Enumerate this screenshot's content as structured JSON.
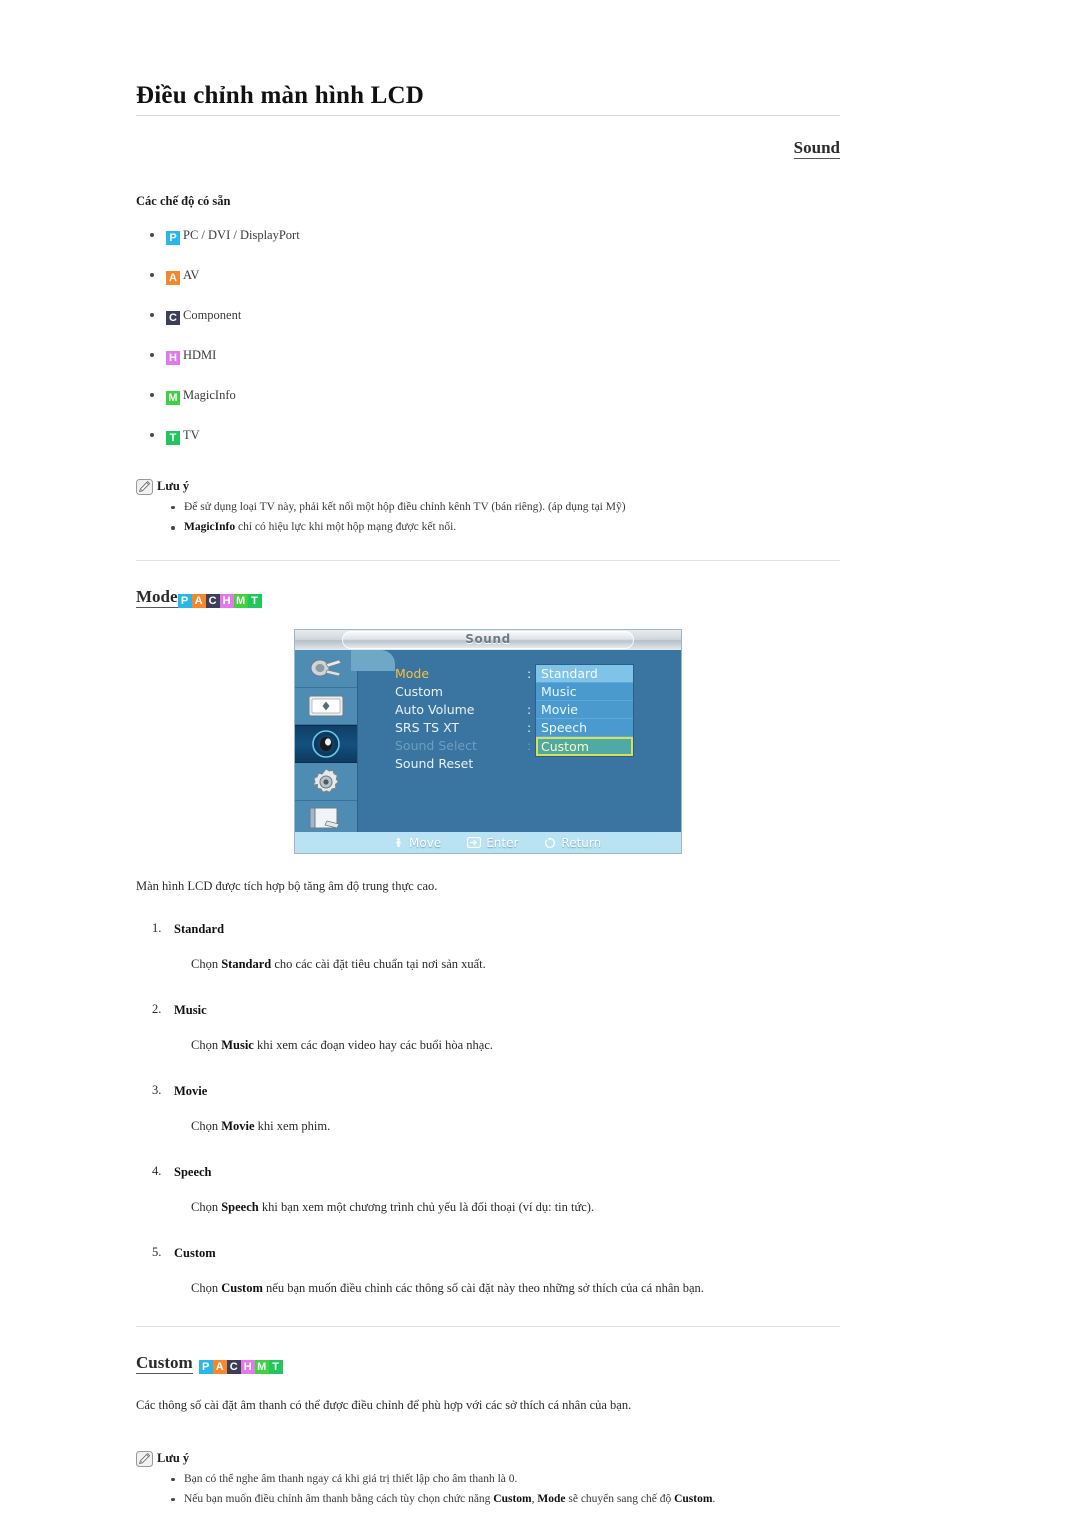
{
  "header": {
    "doc_title": "Điều chỉnh màn hình LCD",
    "section_title": "Sound"
  },
  "available_modes": {
    "heading": "Các chế độ có sẵn",
    "items": [
      {
        "badge": "P",
        "badge_color": "#29b6e8",
        "label": "PC / DVI / DisplayPort"
      },
      {
        "badge": "A",
        "badge_color": "#f5872e",
        "label": "AV"
      },
      {
        "badge": "C",
        "badge_color": "#3d3f58",
        "label": "Component"
      },
      {
        "badge": "H",
        "badge_color": "#e07ae8",
        "label": "HDMI"
      },
      {
        "badge": "M",
        "badge_color": "#3fd13f",
        "label": "MagicInfo"
      },
      {
        "badge": "T",
        "badge_color": "#22c55e",
        "label": "TV"
      }
    ]
  },
  "note_top": {
    "icon": "note-pencil-icon",
    "title": "Lưu ý",
    "items": [
      {
        "prefix": "",
        "bold": "",
        "text": "Để sử dụng loại TV này, phải kết nối một hộp điều chỉnh kênh TV (bán riêng). (áp dụng tại Mỹ)"
      },
      {
        "prefix": "",
        "bold": "MagicInfo",
        "text": " chỉ có hiệu lực khi một hộp mạng được kết nối."
      }
    ]
  },
  "mode_block": {
    "heading": "Mode",
    "badges": [
      {
        "badge": "P",
        "badge_color": "#29b6e8"
      },
      {
        "badge": "A",
        "badge_color": "#f5872e"
      },
      {
        "badge": "C",
        "badge_color": "#3d3f58"
      },
      {
        "badge": "H",
        "badge_color": "#e07ae8"
      },
      {
        "badge": "M",
        "badge_color": "#3fd13f"
      },
      {
        "badge": "T",
        "badge_color": "#22c55e"
      }
    ],
    "intro": "Màn hình LCD được tích hợp bộ tăng âm độ trung thực cao.",
    "items": [
      {
        "num": "1.",
        "title": "Standard",
        "desc_pre": "Chọn ",
        "desc_bold": "Standard",
        "desc_post": " cho các cài đặt tiêu chuẩn tại nơi sản xuất."
      },
      {
        "num": "2.",
        "title": "Music",
        "desc_pre": "Chọn ",
        "desc_bold": "Music",
        "desc_post": " khi xem các đoạn video hay các buổi hòa nhạc."
      },
      {
        "num": "3.",
        "title": "Movie",
        "desc_pre": "Chọn ",
        "desc_bold": "Movie",
        "desc_post": " khi xem phim."
      },
      {
        "num": "4.",
        "title": "Speech",
        "desc_pre": "Chọn ",
        "desc_bold": "Speech",
        "desc_post": " khi bạn xem một chương trình chủ yếu là đối thoại (ví dụ: tin tức)."
      },
      {
        "num": "5.",
        "title": "Custom",
        "desc_pre": "Chọn ",
        "desc_bold": "Custom",
        "desc_post": " nếu bạn muốn điều chỉnh các thông số cài đặt này theo những sở thích của cá nhân bạn."
      }
    ]
  },
  "osd": {
    "title": "Sound",
    "sidebar_icons": [
      "input-source-icon",
      "picture-icon",
      "sound-icon",
      "setup-gear-icon",
      "multi-control-icon"
    ],
    "active_sidebar_index": 2,
    "menu_items": [
      {
        "label": "Mode",
        "state": "selected",
        "colon": ":"
      },
      {
        "label": "Custom",
        "state": "normal",
        "colon": ""
      },
      {
        "label": "Auto Volume",
        "state": "normal",
        "colon": ":"
      },
      {
        "label": "SRS TS XT",
        "state": "normal",
        "colon": ":"
      },
      {
        "label": "Sound Select",
        "state": "disabled",
        "colon": ":"
      },
      {
        "label": "Sound Reset",
        "state": "normal",
        "colon": ""
      }
    ],
    "options": [
      {
        "label": "Standard",
        "state": "first"
      },
      {
        "label": "Music",
        "state": "normal"
      },
      {
        "label": "Movie",
        "state": "normal"
      },
      {
        "label": "Speech",
        "state": "normal"
      },
      {
        "label": "Custom",
        "state": "highlighted"
      }
    ],
    "hints": [
      {
        "icon": "move-dpad-icon",
        "label": "Move"
      },
      {
        "icon": "enter-icon",
        "label": "Enter"
      },
      {
        "icon": "return-icon",
        "label": "Return"
      }
    ]
  },
  "custom_block": {
    "heading": "Custom",
    "badges": [
      {
        "badge": "P",
        "badge_color": "#29b6e8"
      },
      {
        "badge": "A",
        "badge_color": "#f5872e"
      },
      {
        "badge": "C",
        "badge_color": "#3d3f58"
      },
      {
        "badge": "H",
        "badge_color": "#e07ae8"
      },
      {
        "badge": "M",
        "badge_color": "#3fd13f"
      },
      {
        "badge": "T",
        "badge_color": "#22c55e"
      }
    ],
    "intro": "Các thông số cài đặt âm thanh có thể được điều chỉnh để phù hợp với các sở thích cá nhân của bạn."
  },
  "note_bottom": {
    "icon": "note-pencil-icon",
    "title": "Lưu ý",
    "items": [
      {
        "text": "Bạn có thể nghe âm thanh ngay cả khi giá trị thiết lập cho âm thanh là 0."
      },
      {
        "pre": "Nếu bạn muốn điều chỉnh âm thanh bằng cách tùy chọn chức năng ",
        "b1": "Custom",
        "mid": ", ",
        "b2": "Mode",
        "post": " sẽ chuyển sang chế độ ",
        "b3": "Custom",
        "end": "."
      }
    ]
  }
}
